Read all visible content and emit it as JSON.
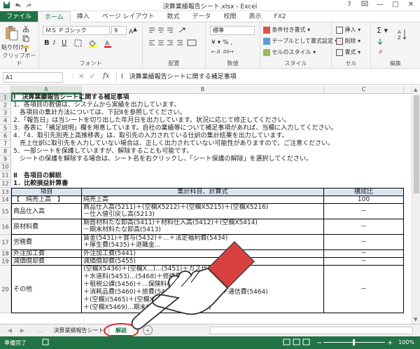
{
  "window": {
    "title": "決算業績報告シート.xlsx - Excel",
    "qat": [
      "save-icon",
      "undo-icon",
      "redo-icon"
    ],
    "controls": [
      "?",
      "ribbon-display-icon",
      "—",
      "□",
      "✕"
    ]
  },
  "ribbon_tabs": [
    {
      "label": "ファイル"
    },
    {
      "label": "ホーム",
      "active": true
    },
    {
      "label": "挿入"
    },
    {
      "label": "ページ レイアウト"
    },
    {
      "label": "数式"
    },
    {
      "label": "データ"
    },
    {
      "label": "校閲"
    },
    {
      "label": "表示"
    },
    {
      "label": "FX2"
    }
  ],
  "ribbon": {
    "clipboard": {
      "paste": "貼り付け",
      "label": "クリップボード"
    },
    "font": {
      "name": "ＭＳ Ｐゴシック",
      "size": "9",
      "label": "フォント",
      "bold": "B",
      "italic": "I",
      "underline": "U"
    },
    "alignment": {
      "label": "配置"
    },
    "number": {
      "format": "標準",
      "label": "数値"
    },
    "styles": {
      "conditional": "条件付き書式",
      "table": "テーブルとして書式設定",
      "cell": "セルのスタイル",
      "label": "スタイル"
    },
    "cells": {
      "insert": "挿入",
      "delete": "削除",
      "format": "書式",
      "label": "セル"
    },
    "editing": {
      "label": "編集"
    }
  },
  "formula_bar": {
    "name_box": "A1",
    "fx": "fx",
    "content": "Ⅰ　決算業績報告シートに関する補足事項"
  },
  "columns": [
    "A",
    "B",
    "C"
  ],
  "sheet_lines": [
    {
      "row": "1",
      "text": "Ⅰ　決算業績報告シートに関する補足事項",
      "bold": true
    },
    {
      "row": "2",
      "text": "1．各項目の数値は、システムから実績を出力しています。"
    },
    {
      "row": "3",
      "text": "　各項目の集計方法については、下記Ⅱを参照してください。"
    },
    {
      "row": "4",
      "text": "2．「報告日」は当シートを切り出した年月日を出力しています。状況に応じて修正してください。"
    },
    {
      "row": "5",
      "text": "3．各表に「補足説明」欄を用意しています。自社の業績等について補足事項があれば、当欄に入力してください。"
    },
    {
      "row": "6",
      "text": "4．「4．取引先別売上高推移表」は、取引先の入力されている仕訳の集計結果を出力しています。"
    },
    {
      "row": "7",
      "text": "　売上仕訳に取引先を入力していない場合は、正しく出力されていない可能性がありますので、ご注意ください。"
    },
    {
      "row": "8",
      "text": "5．一部シートを保護していますが、解除することも可能です。"
    },
    {
      "row": "9",
      "text": "　シートの保護を解除する場合は、シート名を右クリックし、「シート保護の解除」を選択してください。"
    },
    {
      "row": "10",
      "text": ""
    },
    {
      "row": "11",
      "text": "Ⅱ　各項目の解説",
      "bold": true
    },
    {
      "row": "12",
      "text": "1．比較損益計算書",
      "bold": true
    }
  ],
  "table": {
    "header": {
      "row": "13",
      "item": "項目",
      "formula": "集計科目、計算式",
      "ratio": "構成比"
    },
    "rows": [
      {
        "row": "14",
        "item": "【　純売上高　】",
        "formula": [
          "純売上高"
        ],
        "ratio": "100"
      },
      {
        "row": "15",
        "item": "商品仕入高",
        "formula": [
          "商品仕入高(5211)＋(空欄X5212)＋(空欄X5215)＋(空欄X5216)",
          "－仕入値引戻し高(5213)"
        ],
        "ratio": "－"
      },
      {
        "row": "16",
        "item": "原材料費",
        "formula": [
          "期首材料たな卸高(5411)＋材料仕入高(5412)＋(空欄X5414)",
          "－期末材料たな卸高(5413)"
        ],
        "ratio": "－"
      },
      {
        "row": "17",
        "item": "労務費",
        "formula": [
          "賃金(5431)＋賞与(5432)＋...＋法定福利費(5434)",
          "＋厚生費(5435)＋退職金..."
        ],
        "ratio": "－"
      },
      {
        "row": "18",
        "item": "外注加工費",
        "formula": [
          "外注加工費(5441)"
        ],
        "ratio": "－"
      },
      {
        "row": "19",
        "item": "減価償却費",
        "formula": [
          "減価償却費(5455)"
        ],
        "ratio": "－"
      },
      {
        "row": "20",
        "item": "その他",
        "formula": [
          "(空欄X5436)＋(空欄X...)...(5451)＋ガス代(5452)",
          "＋水道料(5453)...(5468)＋修繕費(5456)",
          "＋租税公課(5456)＋...保険料(5459)",
          "＋消耗品費(5460)＋旅費(5462)＋交通費(5463)＋通信費(5464)",
          "＋(空欄)(5465)＋(空欄X5466)＋雑費(5467)",
          "＋(空欄X5469)...期末仕掛品たな卸高(5484)"
        ],
        "ratio": "－"
      }
    ]
  },
  "sheet_tabs": [
    {
      "label": "決算業績報告シート"
    },
    {
      "label": "解説",
      "active": true
    }
  ],
  "status": {
    "ready": "準備完了",
    "zoom": "100%"
  },
  "colors": {
    "excel_green": "#217346",
    "header_fill": "#dbe5f1",
    "highlight_ring": "#e02020"
  }
}
